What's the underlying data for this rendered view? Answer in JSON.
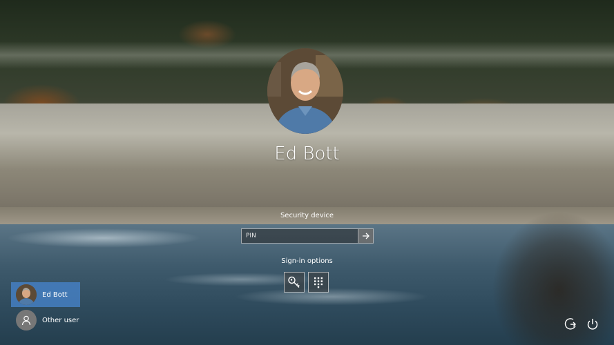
{
  "lock_screen": {
    "user_name": "Ed Bott",
    "security_device_label": "Security device",
    "pin": {
      "placeholder": "PIN",
      "value": ""
    },
    "signin_options_label": "Sign-in options",
    "signin_options": [
      {
        "icon": "security-key-icon"
      },
      {
        "icon": "pin-keypad-icon"
      }
    ]
  },
  "user_list": [
    {
      "name": "Ed Bott",
      "selected": true,
      "icon": "user-photo"
    },
    {
      "name": "Other user",
      "selected": false,
      "icon": "person-icon"
    }
  ],
  "corner_buttons": [
    {
      "icon": "ease-of-access-icon"
    },
    {
      "icon": "power-icon"
    }
  ],
  "colors": {
    "selected_tile": "#4682c8",
    "text": "#ffffff"
  }
}
